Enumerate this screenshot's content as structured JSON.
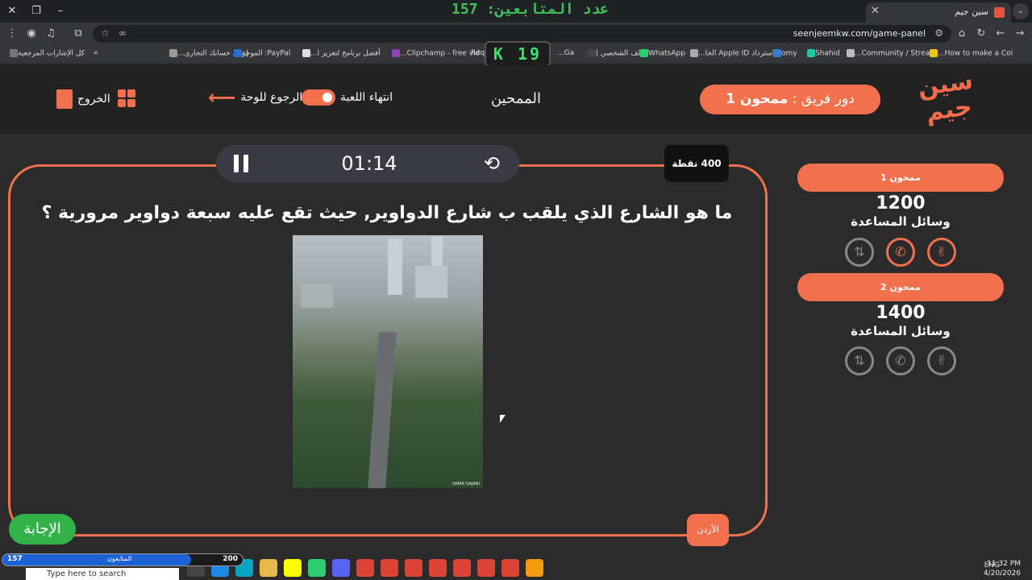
{
  "browser": {
    "viewers_overlay": "عدد المتابعين: 157",
    "tab_title": "سين جيم",
    "url": "seenjeemkw.com/game-panel",
    "bookmarks": [
      "كل الإشارات المرجعية",
      "إعداد حسابك التجاري...",
      "PayPal: الموجز",
      "أفضل برنامج لتعزيز ا...",
      "Clipchamp - free vid...",
      "Requ",
      "Ga...",
      "الملف الشخصي |",
      "WhatsApp",
      "استرداد Apple ID الخا...",
      "omy",
      "Shahid",
      "Community / Strea...",
      "How to make a Coi..."
    ],
    "counter_badge": "K 19"
  },
  "header": {
    "logo_text": "سين جيم",
    "turn_label": "دور فريق :",
    "turn_team": "ممحون 1",
    "center_title": "الممحين",
    "actions": {
      "end_game": "انتهاء اللعبة",
      "back_to_board": "الرجوع للوحة",
      "exit": "الخروج"
    }
  },
  "question_panel": {
    "timer": "01:14",
    "points": "400 نقطة",
    "question": "ما هو الشارع الذي يلقب ب شارع الدواوير, حيث تقع عليه سبعة دواوير مرورية ؟",
    "image_credit": "OMAR DAJANI",
    "category_tag": "الأردن",
    "answer_button": "الإجابة"
  },
  "teams": [
    {
      "name": "ممحون 1",
      "score": "1200",
      "aids_label": "وسائل المساعدة"
    },
    {
      "name": "ممحون 2",
      "score": "1400",
      "aids_label": "وسائل المساعدة"
    }
  ],
  "viewer_bar": {
    "current": "157",
    "label": "المتابعون",
    "goal": "200",
    "progress_fraction": 0.785
  },
  "taskbar": {
    "search_placeholder": "Type here to search",
    "lang": "ENG",
    "time": "11:32 PM",
    "date": "4/20/2026"
  },
  "colors": {
    "accent": "#f2704d",
    "answer": "#34b24a",
    "viewers_text": "#3ec25a"
  }
}
